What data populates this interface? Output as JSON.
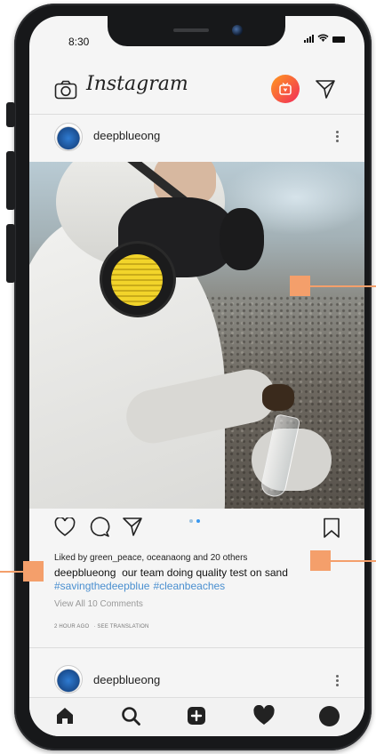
{
  "status_bar": {
    "time": "8:30"
  },
  "header": {
    "logo": "Instagram",
    "camera_icon": "camera-icon",
    "igtv_icon": "igtv-icon",
    "direct_icon": "paper-plane-icon"
  },
  "post": {
    "username": "deepblueong",
    "liked_by": "Liked by green_peace, oceanaong and 20 others",
    "caption_user": "deepblueong",
    "caption_text": "our team doing quality test on sand",
    "hashtags": [
      "#savingthedeepblue",
      "#cleanbeaches"
    ],
    "view_comments": "View All 10 Comments",
    "time_ago": "2 HOUR AGO",
    "see_translation": "· SEE TRANSLATION",
    "carousel": {
      "count": 2,
      "active_index": 1
    }
  },
  "next_post": {
    "username": "deepblueong"
  },
  "nav": {
    "items": [
      "home-icon",
      "search-icon",
      "add-post-icon",
      "heart-icon",
      "profile-icon"
    ]
  },
  "colors": {
    "accent_marker": "#f49f6b",
    "hashtag": "#4a8fd0",
    "igtv_start": "#ff9a1f",
    "igtv_end": "#f12a5a"
  }
}
